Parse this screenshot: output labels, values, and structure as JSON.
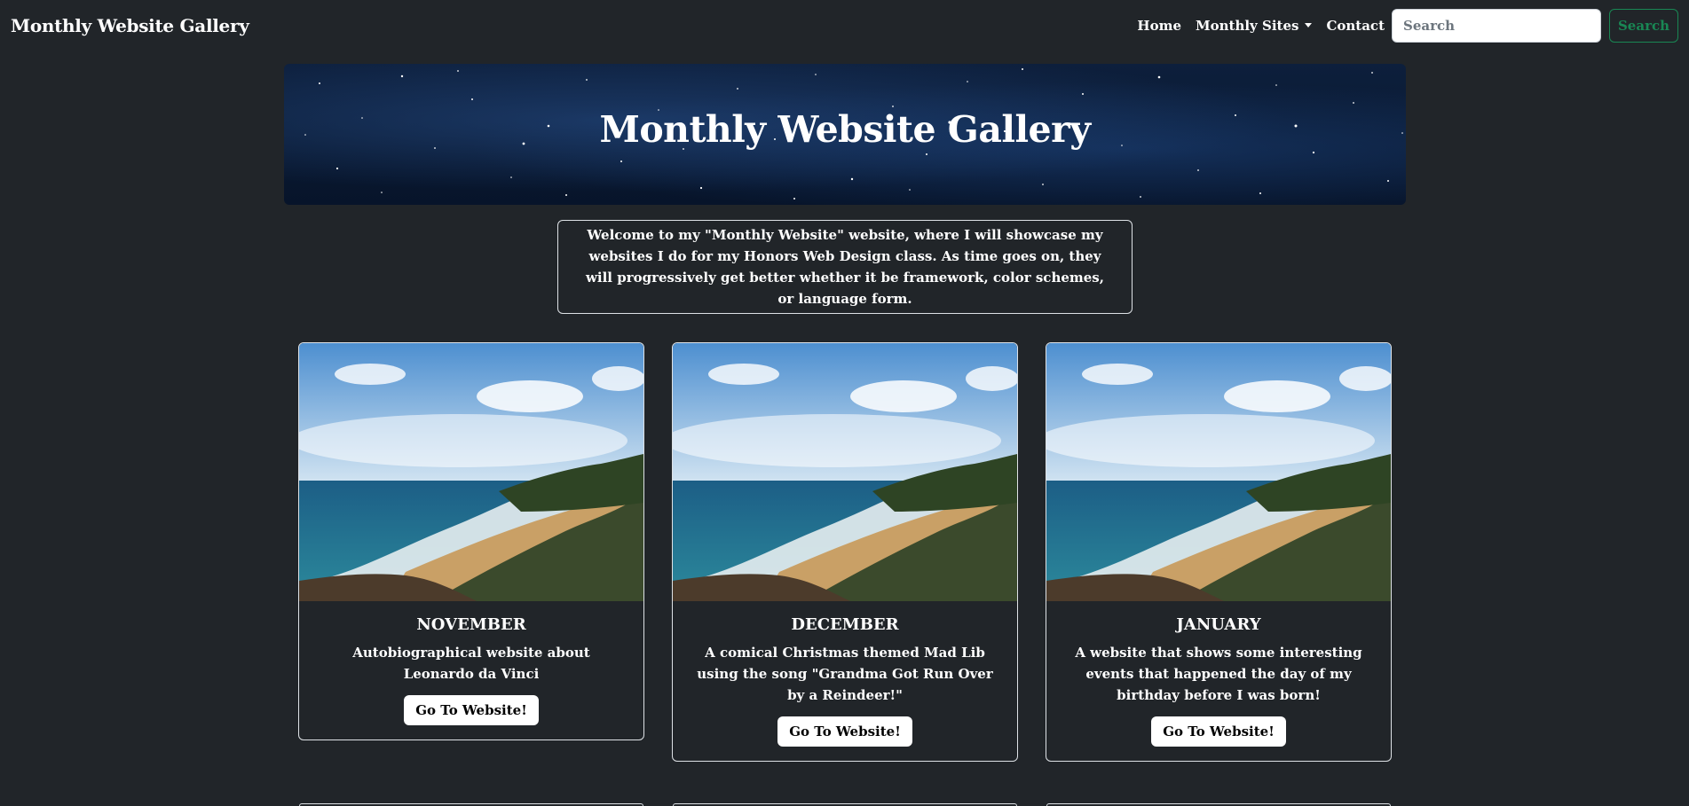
{
  "navbar": {
    "brand": "Monthly Website Gallery",
    "links": {
      "home": "Home",
      "monthly_sites": "Monthly Sites",
      "contact": "Contact"
    },
    "search_placeholder": "Search",
    "search_button": "Search"
  },
  "hero": {
    "title": "Monthly Website Gallery"
  },
  "welcome": {
    "text": "Welcome to my \"Monthly Website\" website, where I will showcase my websites I do for my Honors Web Design class. As time goes on, they will progressively get better whether it be framework, color schemes, or language form."
  },
  "cards": [
    {
      "month": "NOVEMBER",
      "description": "Autobiographical website about Leonardo da Vinci",
      "button": "Go To Website!"
    },
    {
      "month": "DECEMBER",
      "description": "A comical Christmas themed Mad Lib using the song \"Grandma Got Run Over by a Reindeer!\"",
      "button": "Go To Website!"
    },
    {
      "month": "JANUARY",
      "description": "A website that shows some interesting events that happened the day of my birthday before I was born!",
      "button": "Go To Website!"
    }
  ],
  "colors": {
    "background": "#212529",
    "search_button": "#198754",
    "card_button": "#ffffff"
  }
}
